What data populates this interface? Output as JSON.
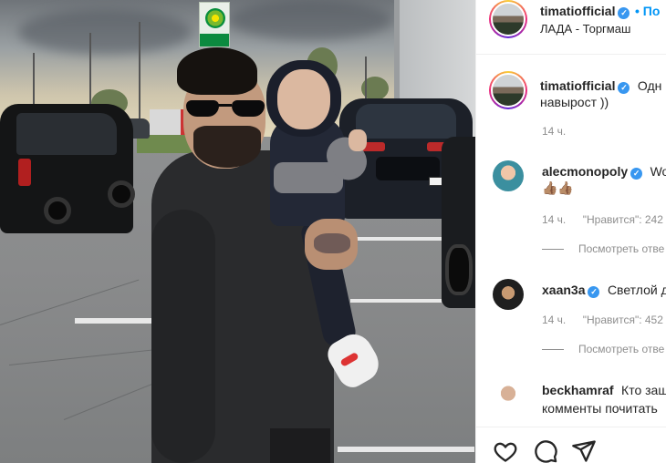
{
  "post": {
    "author": "timatiofficial",
    "follow_label": "• По",
    "location": "ЛАДА - Торгмаш",
    "caption": "Одн",
    "caption_cont": "навырост ))",
    "time": "14 ч."
  },
  "comments": [
    {
      "user": "alecmonopoly",
      "text": "Wo",
      "text2": "👍🏽👍🏽",
      "time": "14 ч.",
      "likes": "\"Нравится\": 242",
      "replies": "Посмотреть отве"
    },
    {
      "user": "xaan3a",
      "text": "Светлой д",
      "time": "14 ч.",
      "likes": "\"Нравится\": 452",
      "replies": "Посмотреть отве"
    },
    {
      "user": "beckhamraf",
      "text": "Кто защ",
      "text2": "комменты почитать"
    }
  ],
  "icons": [
    "heart-icon",
    "comment-icon",
    "share-icon"
  ],
  "colors": {
    "link": "#0095f6",
    "verified": "#3897f0",
    "muted": "#8e8e8e",
    "text": "#262626"
  }
}
